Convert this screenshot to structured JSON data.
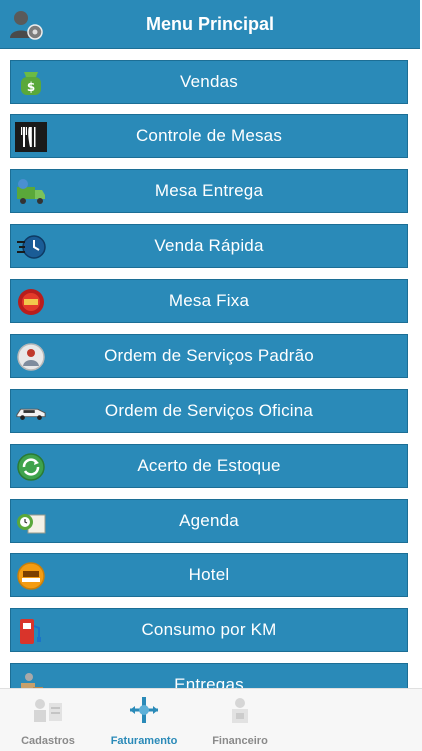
{
  "header": {
    "title": "Menu Principal",
    "avatar_icon": "user-settings-icon"
  },
  "menu": [
    {
      "label": "Vendas",
      "icon": "money-bag-icon"
    },
    {
      "label": "Controle de Mesas",
      "icon": "cutlery-icon"
    },
    {
      "label": "Mesa Entrega",
      "icon": "delivery-truck-icon"
    },
    {
      "label": "Venda Rápida",
      "icon": "fast-clock-icon"
    },
    {
      "label": "Mesa Fixa",
      "icon": "restaurant-sign-icon"
    },
    {
      "label": "Ordem de Serviços Padrão",
      "icon": "service-globe-icon"
    },
    {
      "label": "Ordem de Serviços Oficina",
      "icon": "car-icon"
    },
    {
      "label": "Acerto de Estoque",
      "icon": "refresh-icon"
    },
    {
      "label": "Agenda",
      "icon": "alarm-calendar-icon"
    },
    {
      "label": "Hotel",
      "icon": "hotel-sign-icon"
    },
    {
      "label": "Consumo por KM",
      "icon": "fuel-pump-icon"
    },
    {
      "label": "Entregas",
      "icon": "delivery-person-icon"
    }
  ],
  "tabs": [
    {
      "label": "Cadastros",
      "icon": "registers-icon",
      "active": false
    },
    {
      "label": "Faturamento",
      "icon": "billing-icon",
      "active": true
    },
    {
      "label": "Financeiro",
      "icon": "finance-icon",
      "active": false
    }
  ],
  "colors": {
    "primary": "#2a8ab8",
    "border": "#1c6e95",
    "tab_inactive": "#8a8a8a",
    "tabbar_bg": "#f7f7f7"
  }
}
